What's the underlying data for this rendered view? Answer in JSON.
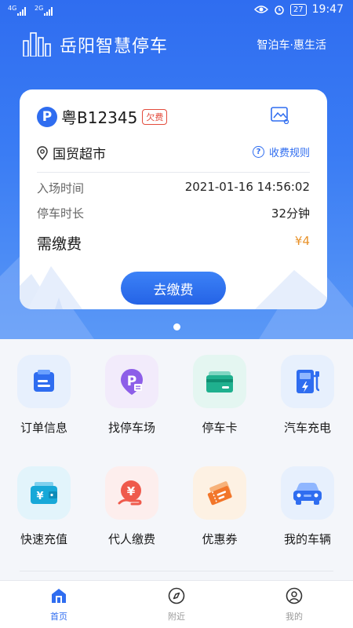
{
  "status_bar": {
    "network_1": "4G",
    "network_2": "2G",
    "battery": "27",
    "time": "19:47"
  },
  "header": {
    "title": "岳阳智慧停车",
    "slogan": "智泊车·惠生活"
  },
  "parking_card": {
    "plate_badge": "P",
    "plate": "粤B12345",
    "status_tag": "欠费",
    "location": "国贸超市",
    "fee_rules": "收费规则",
    "entry_time_label": "入场时间",
    "entry_time_value": "2021-01-16 14:56:02",
    "duration_label": "停车时长",
    "duration_value": "32分钟",
    "amount_due_label": "需缴费",
    "amount_due_value": "¥4",
    "pay_button": "去缴费"
  },
  "services": [
    {
      "label": "订单信息",
      "icon": "order-icon"
    },
    {
      "label": "找停车场",
      "icon": "find-parking-icon"
    },
    {
      "label": "停车卡",
      "icon": "parking-card-icon"
    },
    {
      "label": "汽车充电",
      "icon": "ev-charging-icon"
    },
    {
      "label": "快速充值",
      "icon": "wallet-icon"
    },
    {
      "label": "代人缴费",
      "icon": "pay-for-others-icon"
    },
    {
      "label": "优惠券",
      "icon": "coupon-icon"
    },
    {
      "label": "我的车辆",
      "icon": "car-icon"
    }
  ],
  "tabbar": {
    "home": "首页",
    "nearby": "附近",
    "mine": "我的"
  },
  "colors": {
    "primary": "#2f6df0",
    "warning": "#e8922a",
    "danger": "#e34b3c"
  }
}
